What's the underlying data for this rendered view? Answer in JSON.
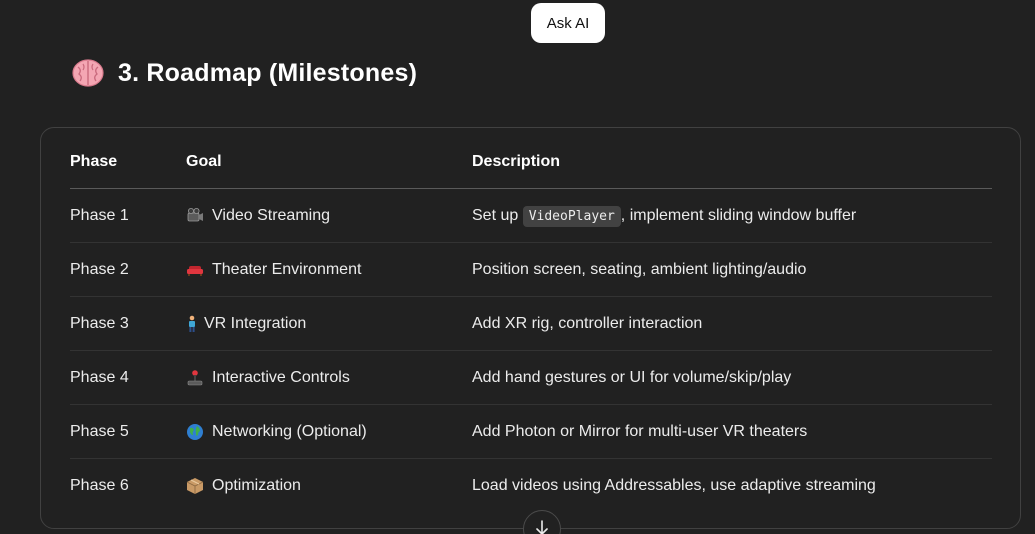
{
  "ask_ai": {
    "label": "Ask AI"
  },
  "heading": {
    "emoji": "brain-icon",
    "title": "3. Roadmap (Milestones)"
  },
  "table": {
    "headers": [
      "Phase",
      "Goal",
      "Description"
    ],
    "rows": [
      {
        "phase": "Phase 1",
        "goal_icon": "film-projector-icon",
        "goal": "Video Streaming",
        "desc_before": "Set up ",
        "desc_code": "VideoPlayer",
        "desc_after": ", implement sliding window buffer"
      },
      {
        "phase": "Phase 2",
        "goal_icon": "couch-icon",
        "goal": "Theater Environment",
        "desc": "Position screen, seating, ambient lighting/audio"
      },
      {
        "phase": "Phase 3",
        "goal_icon": "person-standing-icon",
        "goal": "VR Integration",
        "desc": "Add XR rig, controller interaction"
      },
      {
        "phase": "Phase 4",
        "goal_icon": "joystick-icon",
        "goal": "Interactive Controls",
        "desc": "Add hand gestures or UI for volume/skip/play"
      },
      {
        "phase": "Phase 5",
        "goal_icon": "globe-icon",
        "goal": "Networking (Optional)",
        "desc": "Add Photon or Mirror for multi-user VR theaters"
      },
      {
        "phase": "Phase 6",
        "goal_icon": "package-icon",
        "goal": "Optimization",
        "desc": "Load videos using Addressables, use adaptive streaming"
      }
    ]
  },
  "scroll_down": {
    "icon": "arrow-down-icon"
  },
  "colors": {
    "background": "#212121",
    "table_border": "#414141",
    "text": "#ececec",
    "code_bg": "#424242",
    "ask_ai_bg": "#ffffff"
  }
}
